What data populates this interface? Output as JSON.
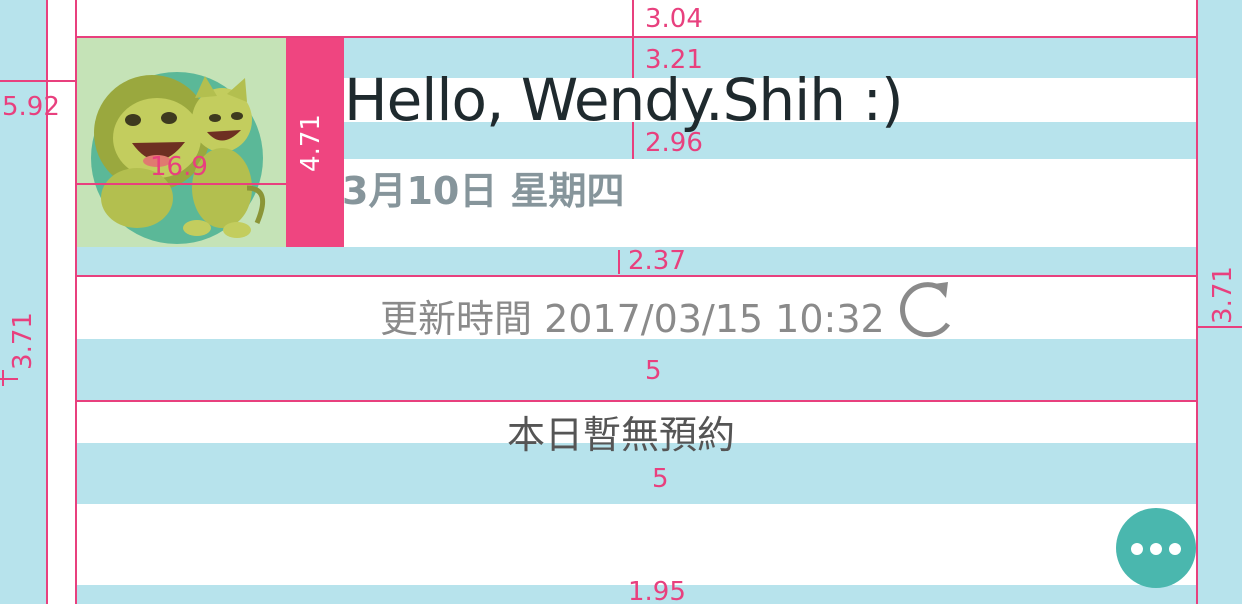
{
  "header": {
    "greeting": "Hello, Wendy.Shih :)",
    "date": "3月10日 星期四"
  },
  "avatar": {
    "icon": "lion-couple-avatar-icon"
  },
  "update": {
    "text": "更新時間 2017/03/15 10:32",
    "icon": "refresh-icon"
  },
  "content": {
    "empty_message": "本日暫無預約"
  },
  "fab": {
    "icon": "more-icon"
  },
  "measurements": {
    "top": "3.04",
    "header_top": "3.21",
    "header_mid": "2.96",
    "header_bottom": "2.37",
    "left_avatar_offset": "5.92",
    "avatar_inner": "16.9",
    "pink_block": "4.71",
    "left_vertical": "3.71",
    "right_vertical": "3.71",
    "gap_1": "5",
    "gap_2": "5",
    "bottom": "1.95"
  },
  "colors": {
    "band": "#b7e3ec",
    "measure": "#e8407e",
    "pink_block": "#ef4580",
    "fab": "#4ab7ae",
    "avatar_bg": "#c5e3b7",
    "avatar_circle": "#5bb898",
    "lion": "#b3bf4f"
  }
}
